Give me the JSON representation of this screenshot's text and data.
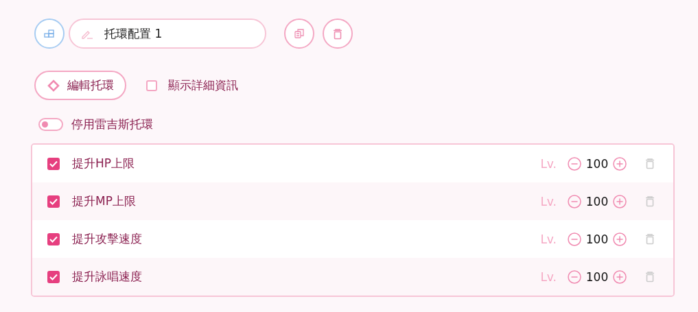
{
  "profile": {
    "name": "托環配置 1"
  },
  "edit_button": {
    "label": "編輯托環"
  },
  "show_details": {
    "label": "顯示詳細資訊",
    "checked": false
  },
  "disable_toggle": {
    "label": "停用雷吉斯托環",
    "on": false
  },
  "rings": [
    {
      "name": "提升HP上限",
      "checked": true,
      "level_label": "Lv.",
      "value": "100"
    },
    {
      "name": "提升MP上限",
      "checked": true,
      "level_label": "Lv.",
      "value": "100"
    },
    {
      "name": "提升攻擊速度",
      "checked": true,
      "level_label": "Lv.",
      "value": "100"
    },
    {
      "name": "提升詠唱速度",
      "checked": true,
      "level_label": "Lv.",
      "value": "100"
    }
  ]
}
